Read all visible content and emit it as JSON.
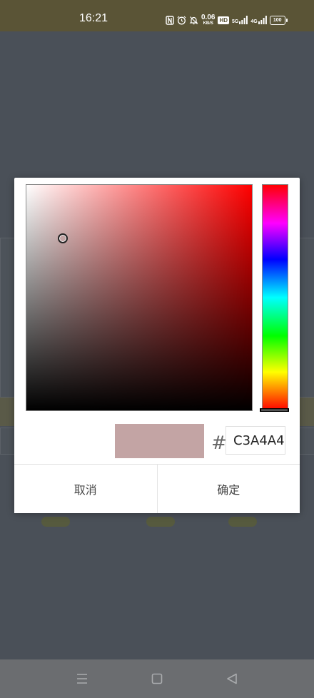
{
  "status_bar": {
    "time": "16:21",
    "speed_value": "0.06",
    "speed_unit": "KB/S",
    "hd_label": "HD",
    "net1": "5G",
    "net2": "4G",
    "battery": "100"
  },
  "color_picker": {
    "selected_color": "#c3a4a4",
    "hue_color": "#ff0000",
    "hash_symbol": "#",
    "hex_value": "C3A4A4",
    "cancel_label": "取消",
    "confirm_label": "确定"
  },
  "nav_bar": {
    "icons": [
      "menu-icon",
      "home-icon",
      "back-icon"
    ]
  }
}
